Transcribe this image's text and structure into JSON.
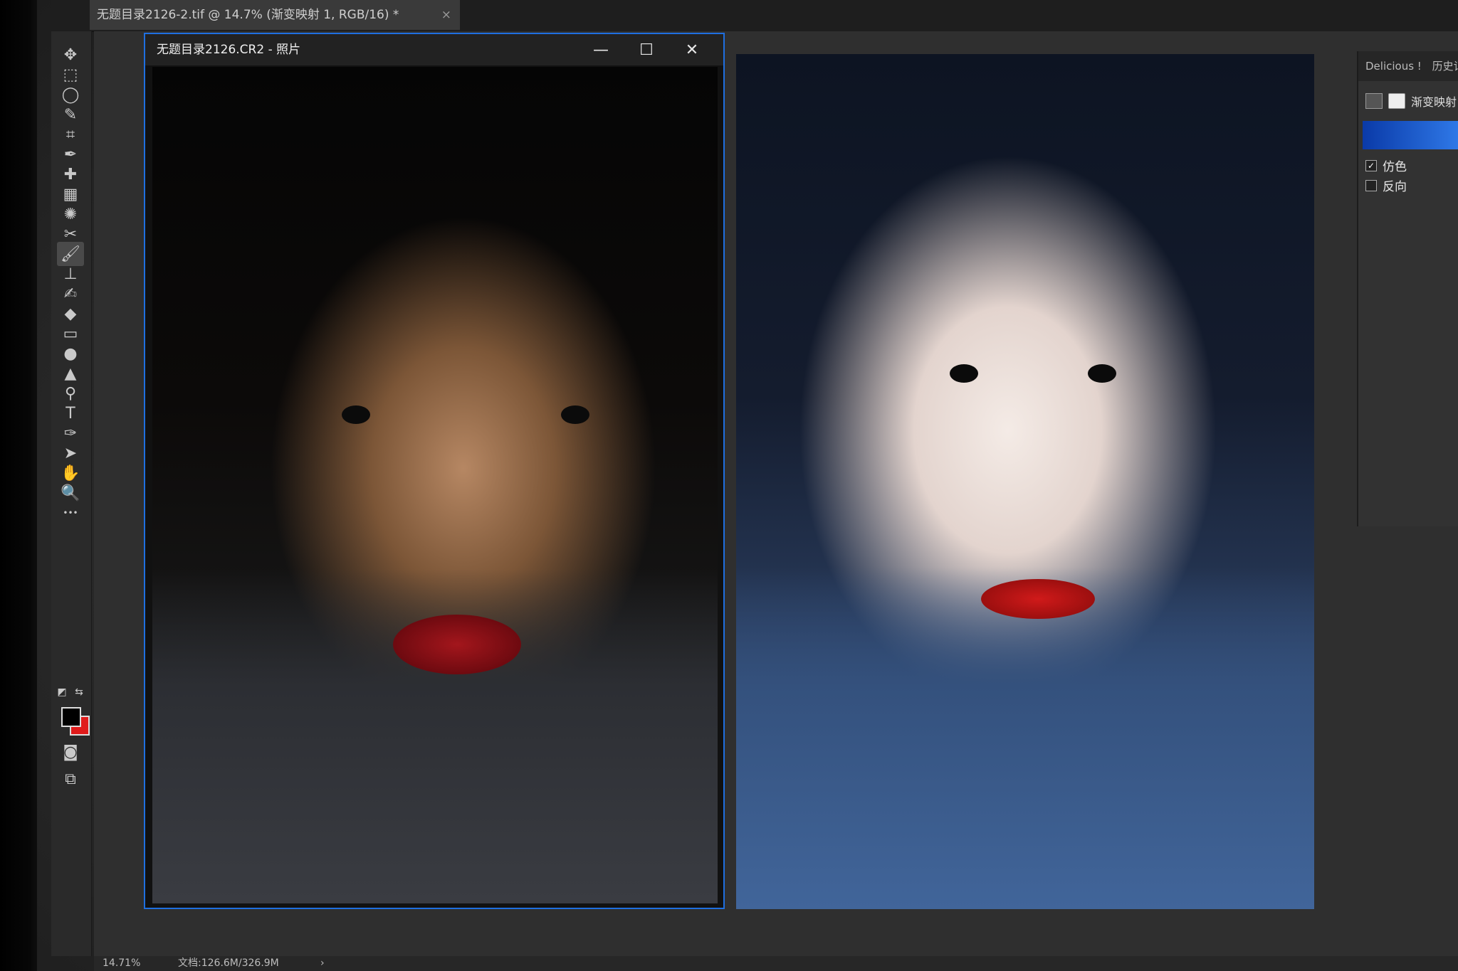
{
  "document_tab": {
    "title": "无题目录2126-2.tif @ 14.7% (渐变映射 1, RGB/16) *",
    "close_glyph": "×",
    "collapse_glyph": "»"
  },
  "photo_window": {
    "title": "无题目录2126.CR2 - 照片",
    "minimize_glyph": "—",
    "maximize_glyph": "☐",
    "close_glyph": "✕"
  },
  "toolbar": {
    "tools": [
      {
        "name": "move-tool-icon",
        "glyph": "✥"
      },
      {
        "name": "marquee-tool-icon",
        "glyph": "⬚"
      },
      {
        "name": "lasso-tool-icon",
        "glyph": "◯"
      },
      {
        "name": "quick-select-tool-icon",
        "glyph": "✎"
      },
      {
        "name": "crop-tool-icon",
        "glyph": "⌗"
      },
      {
        "name": "eyedropper-tool-icon",
        "glyph": "✒"
      },
      {
        "name": "healing-brush-tool-icon",
        "glyph": "✚"
      },
      {
        "name": "patch-tool-icon",
        "glyph": "▦"
      },
      {
        "name": "content-aware-tool-icon",
        "glyph": "✺"
      },
      {
        "name": "red-eye-tool-icon",
        "glyph": "✂"
      },
      {
        "name": "brush-tool-icon",
        "glyph": "🖌",
        "active": true
      },
      {
        "name": "clone-stamp-tool-icon",
        "glyph": "⊥"
      },
      {
        "name": "history-brush-tool-icon",
        "glyph": "✍"
      },
      {
        "name": "eraser-tool-icon",
        "glyph": "◆"
      },
      {
        "name": "gradient-tool-icon",
        "glyph": "▭"
      },
      {
        "name": "blur-tool-icon",
        "glyph": "●"
      },
      {
        "name": "sharpen-tool-icon",
        "glyph": "▲"
      },
      {
        "name": "dodge-tool-icon",
        "glyph": "⚲"
      },
      {
        "name": "type-tool-icon",
        "glyph": "T"
      },
      {
        "name": "pen-tool-icon",
        "glyph": "✑"
      },
      {
        "name": "path-select-tool-icon",
        "glyph": "➤"
      },
      {
        "name": "hand-tool-icon",
        "glyph": "✋"
      },
      {
        "name": "zoom-tool-icon",
        "glyph": "🔍"
      },
      {
        "name": "more-tools-icon",
        "glyph": "•••"
      }
    ],
    "swap_colors_glyph": "⇆",
    "default_colors_glyph": "◩",
    "quick_mask_glyph": "◙",
    "screen_mode_glyph": "⧉",
    "foreground_color": "#000000",
    "background_color": "#e01b1b"
  },
  "right_panel": {
    "tab_1": "Delicious !",
    "tab_2": "历史记",
    "layer_label": "渐变映射",
    "gradient_start": "#0a3aa8",
    "gradient_end": "#2f79e8",
    "option_dither": {
      "label": "仿色",
      "checked": true
    },
    "option_reverse": {
      "label": "反向",
      "checked": false
    }
  },
  "statusbar": {
    "zoom": "14.71%",
    "doc_info": "文档:126.6M/326.9M",
    "arrow": "›"
  }
}
